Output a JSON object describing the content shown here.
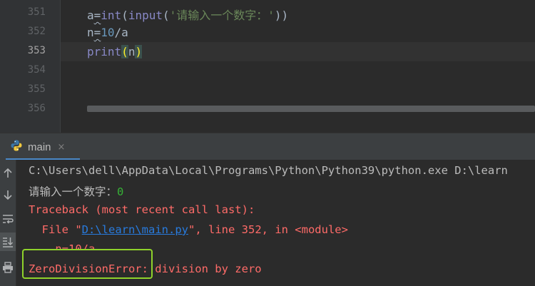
{
  "editor": {
    "line_numbers": [
      "351",
      "352",
      "353",
      "354",
      "355",
      "356"
    ],
    "current_line": "353",
    "code": {
      "line351": {
        "var": "a",
        "eq": "=",
        "func1": "int",
        "open1": "(",
        "func2": "input",
        "open2": "(",
        "str": "'请输入一个数字：'",
        "close": "))"
      },
      "line352": {
        "var": "n",
        "eq": "=",
        "num": "10",
        "rest": "/a"
      },
      "line353": {
        "func": "print",
        "open": "(",
        "arg": "n",
        "close": ")"
      }
    }
  },
  "run_panel": {
    "tab_label": "main",
    "tab_close": "×"
  },
  "toolbar": {
    "buttons": [
      "arrow-up-icon",
      "arrow-down-icon",
      "soft-wrap-icon",
      "scroll-to-end-icon",
      "print-icon"
    ]
  },
  "console": {
    "command": "C:\\Users\\dell\\AppData\\Local\\Programs\\Python\\Python39\\python.exe D:\\learn",
    "prompt": "请输入一个数字：",
    "user_input": "0",
    "traceback_header": "Traceback (most recent call last):",
    "file_prefix": "  File \"",
    "file_link_drive": "D:\\",
    "file_link_dir": "learn",
    "file_link_sep": "\\",
    "file_link_name": "main.py",
    "file_suffix": "\", line 352, in <module>",
    "source_line": "    n=10/a",
    "error_type": "ZeroDivisionError",
    "error_message": ": division by zero"
  },
  "colors": {
    "background": "#2b2b2b",
    "error": "#ff6b68",
    "link": "#287bde",
    "user_input": "#36b236",
    "highlight_box": "#8fd22b",
    "tab_underline": "#4a88c7"
  }
}
